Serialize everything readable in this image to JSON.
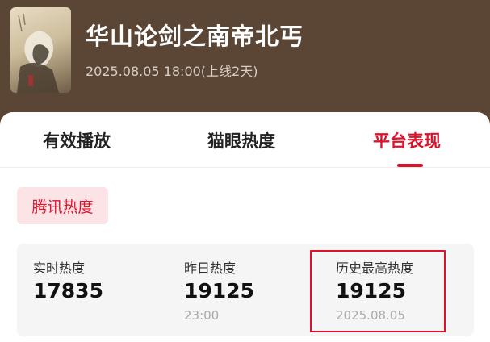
{
  "movie": {
    "title": "华山论剑之南帝北丐",
    "release_info": "2025.08.05 18:00(上线2天)"
  },
  "tabs": [
    {
      "label": "有效播放",
      "active": false
    },
    {
      "label": "猫眼热度",
      "active": false
    },
    {
      "label": "平台表现",
      "active": true
    }
  ],
  "platform_chip": {
    "label": "腾讯热度"
  },
  "stats": [
    {
      "label": "实时热度",
      "value": "17835",
      "sub": ""
    },
    {
      "label": "昨日热度",
      "value": "19125",
      "sub": "23:00"
    },
    {
      "label": "历史最高热度",
      "value": "19125",
      "sub": "2025.08.05"
    }
  ],
  "colors": {
    "header_bg": "#5b4636",
    "accent": "#e0122b",
    "chip_bg": "#fbe3e6",
    "stats_bg": "#f5f5f5"
  }
}
